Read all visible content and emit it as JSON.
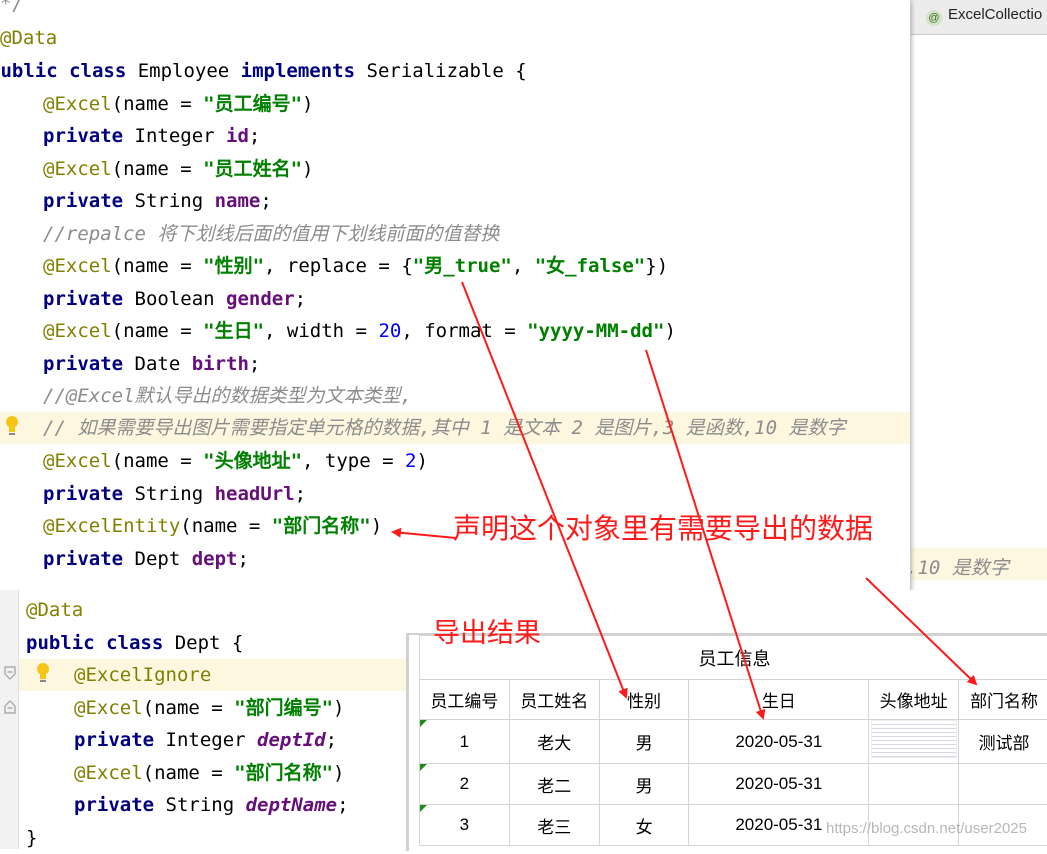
{
  "tab": {
    "label": "ExcelCollectio"
  },
  "background_editor": {
    "visible_text": ",10 是数字"
  },
  "employee_code": {
    "l0": "*/",
    "l1_ann": "@Data",
    "l2_kw1": "public class ",
    "l2_cls": "Employee ",
    "l2_kw2": "implements ",
    "l2_rest": "Serializable {",
    "l3_ann": "@Excel",
    "l3_p1": "(name = ",
    "l3_str": "\"员工编号\"",
    "l3_p2": ")",
    "l4_kw": "private ",
    "l4_type": "Integer ",
    "l4_fld": "id",
    "l4_end": ";",
    "l5_ann": "@Excel",
    "l5_p1": "(name = ",
    "l5_str": "\"员工姓名\"",
    "l5_p2": ")",
    "l6_kw": "private ",
    "l6_type": "String ",
    "l6_fld": "name",
    "l6_end": ";",
    "l7_cmt": "//repalce 将下划线后面的值用下划线前面的值替换",
    "l8_ann": "@Excel",
    "l8_p1": "(name = ",
    "l8_str1": "\"性别\"",
    "l8_p2": ", replace = {",
    "l8_str2": "\"男_true\"",
    "l8_p3": ", ",
    "l8_str3": "\"女_false\"",
    "l8_p4": "})",
    "l9_kw": "private ",
    "l9_type": "Boolean ",
    "l9_fld": "gender",
    "l9_end": ";",
    "l10_ann": "@Excel",
    "l10_p1": "(name = ",
    "l10_str1": "\"生日\"",
    "l10_p2": ", width = ",
    "l10_num": "20",
    "l10_p3": ", format = ",
    "l10_str2": "\"yyyy-MM-dd\"",
    "l10_p4": ")",
    "l11_kw": "private ",
    "l11_type": "Date ",
    "l11_fld": "birth",
    "l11_end": ";",
    "l12_cmt": "//@Excel默认导出的数据类型为文本类型,",
    "l13_cmt": "// 如果需要导出图片需要指定单元格的数据,其中 1 是文本 2 是图片,3 是函数,10 是数字",
    "l14_ann": "@Excel",
    "l14_p1": "(name = ",
    "l14_str": "\"头像地址\"",
    "l14_p2": ", type = ",
    "l14_num": "2",
    "l14_p3": ")",
    "l15_kw": "private ",
    "l15_type": "String ",
    "l15_fld": "headUrl",
    "l15_end": ";",
    "l16_ann": "@ExcelEntity",
    "l16_p1": "(name = ",
    "l16_str": "\"部门名称\"",
    "l16_p2": ")",
    "l17_kw": "private ",
    "l17_type": "Dept ",
    "l17_fld": "dept",
    "l17_end": ";"
  },
  "dept_code": {
    "l1_ann": "@Data",
    "l2_kw": "public class ",
    "l2_rest": "Dept {",
    "l3_ann": "@ExcelIgnore",
    "l4_ann": "@Excel",
    "l4_p1": "(name = ",
    "l4_str": "\"部门编号\"",
    "l4_p2": ")",
    "l5_kw": "private ",
    "l5_type": "Integer ",
    "l5_fld": "deptId",
    "l5_end": ";",
    "l6_ann": "@Excel",
    "l6_p1": "(name = ",
    "l6_str": "\"部门名称\"",
    "l6_p2": ")",
    "l7_kw": "private ",
    "l7_type": "String ",
    "l7_fld": "deptName",
    "l7_end": ";",
    "l8": "}"
  },
  "annotations": {
    "declare": "声明这个对象里有需要导出的数据",
    "result": "导出结果"
  },
  "export_table": {
    "title": "员工信息",
    "headers": [
      "员工编号",
      "员工姓名",
      "性别",
      "生日",
      "头像地址",
      "部门名称"
    ],
    "rows": [
      [
        "1",
        "老大",
        "男",
        "2020-05-31",
        "",
        "测试部"
      ],
      [
        "2",
        "老二",
        "男",
        "2020-05-31",
        "",
        ""
      ],
      [
        "3",
        "老三",
        "女",
        "2020-05-31",
        "",
        ""
      ]
    ]
  },
  "watermark": "https://blog.csdn.net/user2025",
  "colors": {
    "keyword": "#000080",
    "annotation": "#808000",
    "string": "#008000",
    "field": "#660e7a",
    "comment": "#8c8c8c",
    "arrow": "#ff1a1a",
    "highlight_line": "#fdf7e0"
  },
  "icons": [
    "lightbulb-icon",
    "annotation-tab-icon",
    "fold-icon"
  ]
}
